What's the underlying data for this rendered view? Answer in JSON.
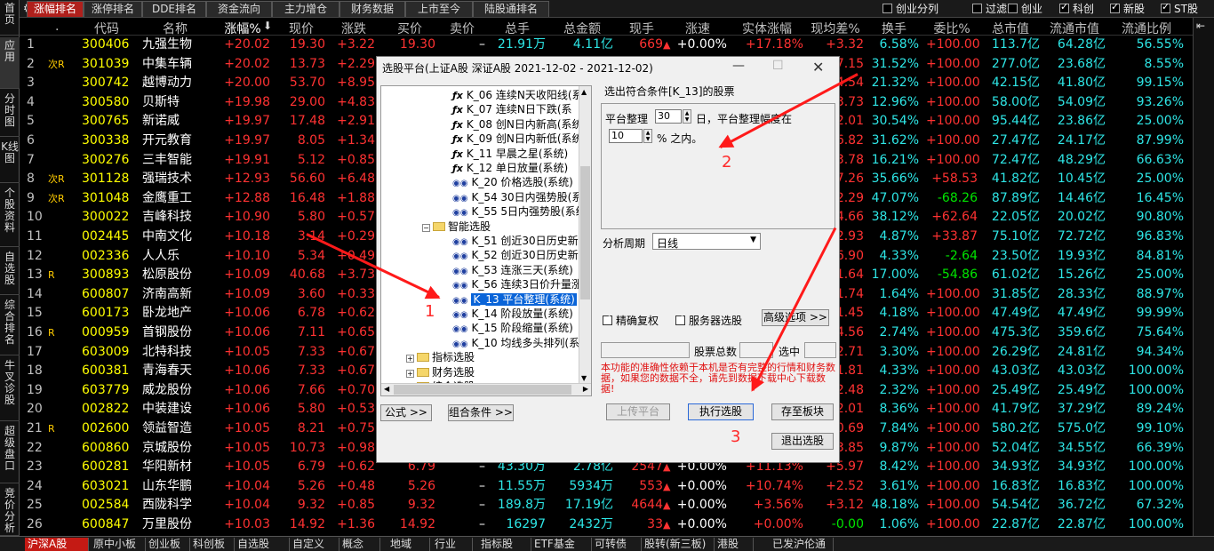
{
  "top_tabs": [
    "涨幅排名",
    "涨停排名",
    "DDE排名",
    "资金流向",
    "主力增仓",
    "财务数据",
    "上市至今",
    "陆股通排名"
  ],
  "top_checks": [
    {
      "label": "创业分列",
      "checked": false
    },
    {
      "label": "过滤",
      "checked": false
    },
    {
      "label": "创业",
      "checked": false
    },
    {
      "label": "科创",
      "checked": true
    },
    {
      "label": "新股",
      "checked": true
    },
    {
      "label": "ST股",
      "checked": true
    }
  ],
  "left_nav": [
    "首页",
    "应用",
    "分时图",
    "K线图",
    "个股资料",
    "自选股",
    "综合排名",
    "牛叉诊股",
    "超级盘口",
    "竞价分析"
  ],
  "columns": [
    "",
    "代码",
    "名称",
    "涨幅%",
    "现价",
    "涨跌",
    "买价",
    "卖价",
    "总手",
    "总金额",
    "现手",
    "涨速",
    "实体涨幅",
    "现均差%",
    "换手",
    "委比%",
    "总市值",
    "流通市值",
    "流通比例"
  ],
  "rows": [
    {
      "n": "1",
      "flag": "",
      "code": "300406",
      "name": "九强生物",
      "pct": "+20.02",
      "price": "19.30",
      "chg": "+3.22",
      "bid": "19.30",
      "ask": "–",
      "vol": "21.91万",
      "amt": "4.11亿",
      "cur": "669",
      "spd": "+0.00%",
      "body": "+17.18%",
      "avgd": "+3.32",
      "turn": "6.58%",
      "wb": "+100.00",
      "mcap": "113.7亿",
      "fcap": "64.28亿",
      "fr": "56.55%"
    },
    {
      "n": "2",
      "flag": "次R",
      "code": "301039",
      "name": "中集车辆",
      "pct": "+20.02",
      "price": "13.73",
      "chg": "+2.29",
      "bid": "",
      "ask": "",
      "vol": "",
      "amt": "",
      "cur": "",
      "spd": "",
      "body": "",
      "avgd": "7.15",
      "turn": "31.52%",
      "wb": "+100.00",
      "mcap": "277.0亿",
      "fcap": "23.68亿",
      "fr": "8.55%"
    },
    {
      "n": "3",
      "flag": "",
      "code": "300742",
      "name": "越博动力",
      "pct": "+20.00",
      "price": "53.70",
      "chg": "+8.95",
      "bid": "",
      "ask": "",
      "vol": "",
      "amt": "",
      "cur": "",
      "spd": "",
      "body": "",
      "avgd": "4.54",
      "turn": "21.32%",
      "wb": "+100.00",
      "mcap": "42.15亿",
      "fcap": "41.80亿",
      "fr": "99.15%"
    },
    {
      "n": "4",
      "flag": "",
      "code": "300580",
      "name": "贝斯特",
      "pct": "+19.98",
      "price": "29.00",
      "chg": "+4.83",
      "bid": "",
      "ask": "",
      "vol": "",
      "amt": "",
      "cur": "",
      "spd": "",
      "body": "",
      "avgd": "3.73",
      "turn": "12.96%",
      "wb": "+100.00",
      "mcap": "58.00亿",
      "fcap": "54.09亿",
      "fr": "93.26%"
    },
    {
      "n": "5",
      "flag": "",
      "code": "300765",
      "name": "新诺威",
      "pct": "+19.97",
      "price": "17.48",
      "chg": "+2.91",
      "bid": "",
      "ask": "",
      "vol": "",
      "amt": "",
      "cur": "",
      "spd": "",
      "body": "",
      "avgd": "2.01",
      "turn": "30.54%",
      "wb": "+100.00",
      "mcap": "95.44亿",
      "fcap": "23.86亿",
      "fr": "25.00%"
    },
    {
      "n": "6",
      "flag": "",
      "code": "300338",
      "name": "开元教育",
      "pct": "+19.97",
      "price": "8.05",
      "chg": "+1.34",
      "bid": "",
      "ask": "",
      "vol": "",
      "amt": "",
      "cur": "",
      "spd": "",
      "body": "",
      "avgd": "6.82",
      "turn": "31.62%",
      "wb": "+100.00",
      "mcap": "27.47亿",
      "fcap": "24.17亿",
      "fr": "87.99%"
    },
    {
      "n": "7",
      "flag": "",
      "code": "300276",
      "name": "三丰智能",
      "pct": "+19.91",
      "price": "5.12",
      "chg": "+0.85",
      "bid": "",
      "ask": "",
      "vol": "",
      "amt": "",
      "cur": "",
      "spd": "",
      "body": "",
      "avgd": "3.78",
      "turn": "16.21%",
      "wb": "+100.00",
      "mcap": "72.47亿",
      "fcap": "48.29亿",
      "fr": "66.63%"
    },
    {
      "n": "8",
      "flag": "次R",
      "code": "301128",
      "name": "强瑞技术",
      "pct": "+12.93",
      "price": "56.60",
      "chg": "+6.48",
      "bid": "",
      "ask": "",
      "vol": "",
      "amt": "",
      "cur": "",
      "spd": "",
      "body": "",
      "avgd": "7.26",
      "turn": "35.66%",
      "wb": "+58.53",
      "mcap": "41.82亿",
      "fcap": "10.45亿",
      "fr": "25.00%"
    },
    {
      "n": "9",
      "flag": "次R",
      "code": "301048",
      "name": "金鹰重工",
      "pct": "+12.88",
      "price": "16.48",
      "chg": "+1.88",
      "bid": "",
      "ask": "",
      "vol": "",
      "amt": "",
      "cur": "",
      "spd": "",
      "body": "",
      "avgd": "2.29",
      "turn": "47.07%",
      "wb": "-68.26",
      "mcap": "87.89亿",
      "fcap": "14.46亿",
      "fr": "16.45%"
    },
    {
      "n": "10",
      "flag": "",
      "code": "300022",
      "name": "吉峰科技",
      "pct": "+10.90",
      "price": "5.80",
      "chg": "+0.57",
      "bid": "",
      "ask": "",
      "vol": "",
      "amt": "",
      "cur": "",
      "spd": "",
      "body": "",
      "avgd": "4.66",
      "turn": "38.12%",
      "wb": "+62.64",
      "mcap": "22.05亿",
      "fcap": "20.02亿",
      "fr": "90.80%"
    },
    {
      "n": "11",
      "flag": "",
      "code": "002445",
      "name": "中南文化",
      "pct": "+10.18",
      "price": "3.14",
      "chg": "+0.29",
      "bid": "",
      "ask": "",
      "vol": "",
      "amt": "",
      "cur": "",
      "spd": "",
      "body": "",
      "avgd": "2.93",
      "turn": "4.87%",
      "wb": "+33.87",
      "mcap": "75.10亿",
      "fcap": "72.72亿",
      "fr": "96.83%"
    },
    {
      "n": "12",
      "flag": "",
      "code": "002336",
      "name": "人人乐",
      "pct": "+10.10",
      "price": "5.34",
      "chg": "+0.49",
      "bid": "",
      "ask": "",
      "vol": "",
      "amt": "",
      "cur": "",
      "spd": "",
      "body": "",
      "avgd": "6.90",
      "turn": "4.33%",
      "wb": "-2.64",
      "mcap": "23.50亿",
      "fcap": "19.93亿",
      "fr": "84.81%"
    },
    {
      "n": "13",
      "flag": "R",
      "code": "300893",
      "name": "松原股份",
      "pct": "+10.09",
      "price": "40.68",
      "chg": "+3.73",
      "bid": "",
      "ask": "",
      "vol": "",
      "amt": "",
      "cur": "",
      "spd": "",
      "body": "",
      "avgd": "1.64",
      "turn": "17.00%",
      "wb": "-54.86",
      "mcap": "61.02亿",
      "fcap": "15.26亿",
      "fr": "25.00%"
    },
    {
      "n": "14",
      "flag": "",
      "code": "600807",
      "name": "济南高新",
      "pct": "+10.09",
      "price": "3.60",
      "chg": "+0.33",
      "bid": "",
      "ask": "",
      "vol": "",
      "amt": "",
      "cur": "",
      "spd": "",
      "body": "",
      "avgd": "1.74",
      "turn": "1.64%",
      "wb": "+100.00",
      "mcap": "31.85亿",
      "fcap": "28.33亿",
      "fr": "88.97%"
    },
    {
      "n": "15",
      "flag": "",
      "code": "600173",
      "name": "卧龙地产",
      "pct": "+10.06",
      "price": "6.78",
      "chg": "+0.62",
      "bid": "",
      "ask": "",
      "vol": "",
      "amt": "",
      "cur": "",
      "spd": "",
      "body": "",
      "avgd": "1.45",
      "turn": "4.18%",
      "wb": "+100.00",
      "mcap": "47.49亿",
      "fcap": "47.49亿",
      "fr": "99.99%"
    },
    {
      "n": "16",
      "flag": "R",
      "code": "000959",
      "name": "首钢股份",
      "pct": "+10.06",
      "price": "7.11",
      "chg": "+0.65",
      "bid": "",
      "ask": "",
      "vol": "",
      "amt": "",
      "cur": "",
      "spd": "",
      "body": "",
      "avgd": "4.56",
      "turn": "2.74%",
      "wb": "+100.00",
      "mcap": "475.3亿",
      "fcap": "359.6亿",
      "fr": "75.64%"
    },
    {
      "n": "17",
      "flag": "",
      "code": "603009",
      "name": "北特科技",
      "pct": "+10.05",
      "price": "7.33",
      "chg": "+0.67",
      "bid": "",
      "ask": "",
      "vol": "",
      "amt": "",
      "cur": "",
      "spd": "",
      "body": "",
      "avgd": "2.71",
      "turn": "3.30%",
      "wb": "+100.00",
      "mcap": "26.29亿",
      "fcap": "24.81亿",
      "fr": "94.34%"
    },
    {
      "n": "18",
      "flag": "",
      "code": "600381",
      "name": "青海春天",
      "pct": "+10.06",
      "price": "7.33",
      "chg": "+0.67",
      "bid": "",
      "ask": "",
      "vol": "",
      "amt": "",
      "cur": "",
      "spd": "",
      "body": "",
      "avgd": "1.81",
      "turn": "4.33%",
      "wb": "+100.00",
      "mcap": "43.03亿",
      "fcap": "43.03亿",
      "fr": "100.00%"
    },
    {
      "n": "19",
      "flag": "",
      "code": "603779",
      "name": "威龙股份",
      "pct": "+10.06",
      "price": "7.66",
      "chg": "+0.70",
      "bid": "",
      "ask": "",
      "vol": "",
      "amt": "",
      "cur": "",
      "spd": "",
      "body": "",
      "avgd": "2.48",
      "turn": "2.32%",
      "wb": "+100.00",
      "mcap": "25.49亿",
      "fcap": "25.49亿",
      "fr": "100.00%"
    },
    {
      "n": "20",
      "flag": "",
      "code": "002822",
      "name": "中装建设",
      "pct": "+10.06",
      "price": "5.80",
      "chg": "+0.53",
      "bid": "",
      "ask": "",
      "vol": "",
      "amt": "",
      "cur": "",
      "spd": "",
      "body": "",
      "avgd": "2.01",
      "turn": "8.36%",
      "wb": "+100.00",
      "mcap": "41.79亿",
      "fcap": "37.29亿",
      "fr": "89.24%"
    },
    {
      "n": "21",
      "flag": "R",
      "code": "002600",
      "name": "领益智造",
      "pct": "+10.05",
      "price": "8.21",
      "chg": "+0.75",
      "bid": "",
      "ask": "",
      "vol": "",
      "amt": "",
      "cur": "",
      "spd": "",
      "body": "",
      "avgd": "0.69",
      "turn": "7.84%",
      "wb": "+100.00",
      "mcap": "580.2亿",
      "fcap": "575.0亿",
      "fr": "99.10%"
    },
    {
      "n": "22",
      "flag": "",
      "code": "600860",
      "name": "京城股份",
      "pct": "+10.05",
      "price": "10.73",
      "chg": "+0.98",
      "bid": "",
      "ask": "",
      "vol": "",
      "amt": "",
      "cur": "",
      "spd": "",
      "body": "",
      "avgd": "3.85",
      "turn": "9.87%",
      "wb": "+100.00",
      "mcap": "52.04亿",
      "fcap": "34.55亿",
      "fr": "66.39%"
    },
    {
      "n": "23",
      "flag": "",
      "code": "600281",
      "name": "华阳新材",
      "pct": "+10.05",
      "price": "6.79",
      "chg": "+0.62",
      "bid": "6.79",
      "ask": "–",
      "vol": "43.30万",
      "amt": "2.78亿",
      "cur": "2547",
      "spd": "+0.00%",
      "body": "+11.13%",
      "avgd": "+5.97",
      "turn": "8.42%",
      "wb": "+100.00",
      "mcap": "34.93亿",
      "fcap": "34.93亿",
      "fr": "100.00%"
    },
    {
      "n": "24",
      "flag": "",
      "code": "603021",
      "name": "山东华鹏",
      "pct": "+10.04",
      "price": "5.26",
      "chg": "+0.48",
      "bid": "5.26",
      "ask": "–",
      "vol": "11.55万",
      "amt": "5934万",
      "cur": "553",
      "spd": "+0.00%",
      "body": "+10.74%",
      "avgd": "+2.52",
      "turn": "3.61%",
      "wb": "+100.00",
      "mcap": "16.83亿",
      "fcap": "16.83亿",
      "fr": "100.00%"
    },
    {
      "n": "25",
      "flag": "",
      "code": "002584",
      "name": "西陇科学",
      "pct": "+10.04",
      "price": "9.32",
      "chg": "+0.85",
      "bid": "9.32",
      "ask": "–",
      "vol": "189.8万",
      "amt": "17.19亿",
      "cur": "4644",
      "spd": "+0.00%",
      "body": "+3.56%",
      "avgd": "+3.12",
      "turn": "48.18%",
      "wb": "+100.00",
      "mcap": "54.54亿",
      "fcap": "36.72亿",
      "fr": "67.32%"
    },
    {
      "n": "26",
      "flag": "",
      "code": "600847",
      "name": "万里股份",
      "pct": "+10.03",
      "price": "14.92",
      "chg": "+1.36",
      "bid": "14.92",
      "ask": "–",
      "vol": "16297",
      "amt": "2432万",
      "cur": "33",
      "spd": "+0.00%",
      "body": "+0.00%",
      "avgd": "-0.00",
      "turn": "1.06%",
      "wb": "+100.00",
      "mcap": "22.87亿",
      "fcap": "22.87亿",
      "fr": "100.00%"
    }
  ],
  "bottom_tabs": [
    "沪深A股",
    "原中小板",
    "创业板",
    "科创板",
    "自选股",
    "自定义",
    "概念",
    "地域",
    "行业",
    "指标股",
    "ETF基金",
    "可转债",
    "股转(新三板)",
    "港股",
    "已发沪伦通"
  ],
  "dialog": {
    "title": "选股平台(上证A股 深证A股   2021-12-02 - 2021-12-02)",
    "tree": [
      {
        "type": "fx",
        "text": "K_06 连续N天收阳线(系"
      },
      {
        "type": "fx",
        "text": "K_07 连续N日下跌(系"
      },
      {
        "type": "fx",
        "text": "K_08 创N日内新高(系统"
      },
      {
        "type": "fx",
        "text": "K_09 创N日内新低(系统"
      },
      {
        "type": "fx",
        "text": "K_11 早晨之星(系统)"
      },
      {
        "type": "fx",
        "text": "K_12 单日放量(系统)"
      },
      {
        "type": "bi",
        "text": "K_20 价格选股(系统)"
      },
      {
        "type": "bi",
        "text": "K_54 30日内强势股(系统"
      },
      {
        "type": "bi",
        "text": "K_55 5日内强势股(系统"
      },
      {
        "type": "folder",
        "text": "智能选股"
      },
      {
        "type": "bi",
        "text": "K_51 创近30日历史新高"
      },
      {
        "type": "bi",
        "text": "K_52 创近30日历史新低"
      },
      {
        "type": "bi",
        "text": "K_53 连涨三天(系统)"
      },
      {
        "type": "bi",
        "text": "K_56 连续3日价升量涨"
      },
      {
        "type": "bi",
        "text": "K_13 平台整理(系统)",
        "selected": true
      },
      {
        "type": "bi",
        "text": "K_14 阶段放量(系统)"
      },
      {
        "type": "bi",
        "text": "K_15 阶段缩量(系统)"
      },
      {
        "type": "bi",
        "text": "K_10 均线多头排列(系"
      },
      {
        "type": "folder2",
        "text": "指标选股"
      },
      {
        "type": "folder2",
        "text": "财务选股"
      },
      {
        "type": "folder2",
        "text": "综合选股"
      }
    ],
    "cond_title": "选出符合条件[K_13]的股票",
    "cond_prefix": "平台整理",
    "cond_days": "30",
    "cond_mid": "日，平台整理幅度在",
    "cond_range": "10",
    "cond_suffix": "% 之内。",
    "period_label": "分析周期",
    "period_value": "日线",
    "chk_fuquan": "精确复权",
    "chk_server": "服务器选股",
    "adv_btn": "高级选项 >>",
    "total_label": "股票总数",
    "selected_label": "选中",
    "warning": "本功能的准确性依赖于本机是否有完整的行情和财务数据，如果您的数据不全，请先到数据下载中心下载数据!",
    "btn_formula": "公式 >>",
    "btn_combo": "组合条件 >>",
    "btn_upload": "上传平台",
    "btn_exec": "执行选股",
    "btn_save": "存至板块",
    "btn_exit": "退出选股"
  },
  "annotations": [
    "1",
    "2",
    "3"
  ],
  "colors": {
    "up": "#ff3232",
    "down": "#00e400",
    "code": "#ffff00",
    "cyan": "#2ee6e6",
    "active_tab": "#b0201c",
    "arrow": "#ff1a1a"
  }
}
